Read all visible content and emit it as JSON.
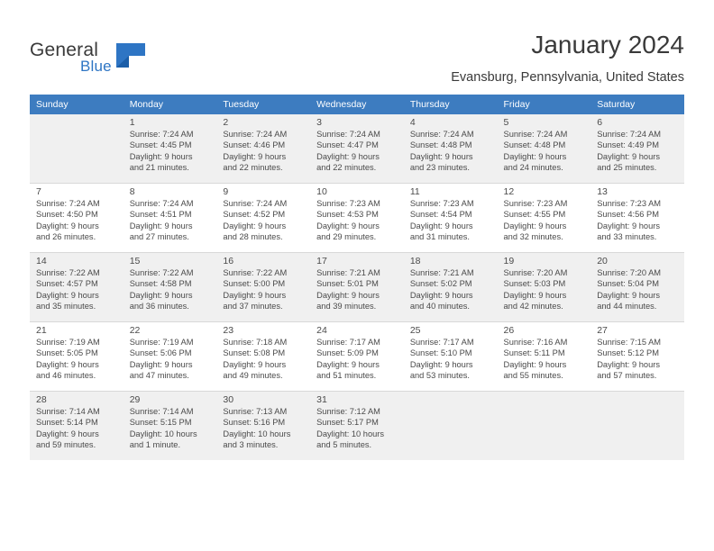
{
  "brand": {
    "name_part1": "General",
    "name_part2": "Blue",
    "logo_icon": "blue-flag-icon"
  },
  "header": {
    "title": "January 2024",
    "subtitle": "Evansburg, Pennsylvania, United States",
    "accent_color": "#3d7cc0",
    "alt_row_color": "#f0f0f0"
  },
  "calendar": {
    "weekdays": [
      "Sunday",
      "Monday",
      "Tuesday",
      "Wednesday",
      "Thursday",
      "Friday",
      "Saturday"
    ],
    "weeks": [
      [
        {
          "day": "",
          "sunrise": "",
          "sunset": "",
          "daylight1": "",
          "daylight2": ""
        },
        {
          "day": "1",
          "sunrise": "Sunrise: 7:24 AM",
          "sunset": "Sunset: 4:45 PM",
          "daylight1": "Daylight: 9 hours",
          "daylight2": "and 21 minutes."
        },
        {
          "day": "2",
          "sunrise": "Sunrise: 7:24 AM",
          "sunset": "Sunset: 4:46 PM",
          "daylight1": "Daylight: 9 hours",
          "daylight2": "and 22 minutes."
        },
        {
          "day": "3",
          "sunrise": "Sunrise: 7:24 AM",
          "sunset": "Sunset: 4:47 PM",
          "daylight1": "Daylight: 9 hours",
          "daylight2": "and 22 minutes."
        },
        {
          "day": "4",
          "sunrise": "Sunrise: 7:24 AM",
          "sunset": "Sunset: 4:48 PM",
          "daylight1": "Daylight: 9 hours",
          "daylight2": "and 23 minutes."
        },
        {
          "day": "5",
          "sunrise": "Sunrise: 7:24 AM",
          "sunset": "Sunset: 4:48 PM",
          "daylight1": "Daylight: 9 hours",
          "daylight2": "and 24 minutes."
        },
        {
          "day": "6",
          "sunrise": "Sunrise: 7:24 AM",
          "sunset": "Sunset: 4:49 PM",
          "daylight1": "Daylight: 9 hours",
          "daylight2": "and 25 minutes."
        }
      ],
      [
        {
          "day": "7",
          "sunrise": "Sunrise: 7:24 AM",
          "sunset": "Sunset: 4:50 PM",
          "daylight1": "Daylight: 9 hours",
          "daylight2": "and 26 minutes."
        },
        {
          "day": "8",
          "sunrise": "Sunrise: 7:24 AM",
          "sunset": "Sunset: 4:51 PM",
          "daylight1": "Daylight: 9 hours",
          "daylight2": "and 27 minutes."
        },
        {
          "day": "9",
          "sunrise": "Sunrise: 7:24 AM",
          "sunset": "Sunset: 4:52 PM",
          "daylight1": "Daylight: 9 hours",
          "daylight2": "and 28 minutes."
        },
        {
          "day": "10",
          "sunrise": "Sunrise: 7:23 AM",
          "sunset": "Sunset: 4:53 PM",
          "daylight1": "Daylight: 9 hours",
          "daylight2": "and 29 minutes."
        },
        {
          "day": "11",
          "sunrise": "Sunrise: 7:23 AM",
          "sunset": "Sunset: 4:54 PM",
          "daylight1": "Daylight: 9 hours",
          "daylight2": "and 31 minutes."
        },
        {
          "day": "12",
          "sunrise": "Sunrise: 7:23 AM",
          "sunset": "Sunset: 4:55 PM",
          "daylight1": "Daylight: 9 hours",
          "daylight2": "and 32 minutes."
        },
        {
          "day": "13",
          "sunrise": "Sunrise: 7:23 AM",
          "sunset": "Sunset: 4:56 PM",
          "daylight1": "Daylight: 9 hours",
          "daylight2": "and 33 minutes."
        }
      ],
      [
        {
          "day": "14",
          "sunrise": "Sunrise: 7:22 AM",
          "sunset": "Sunset: 4:57 PM",
          "daylight1": "Daylight: 9 hours",
          "daylight2": "and 35 minutes."
        },
        {
          "day": "15",
          "sunrise": "Sunrise: 7:22 AM",
          "sunset": "Sunset: 4:58 PM",
          "daylight1": "Daylight: 9 hours",
          "daylight2": "and 36 minutes."
        },
        {
          "day": "16",
          "sunrise": "Sunrise: 7:22 AM",
          "sunset": "Sunset: 5:00 PM",
          "daylight1": "Daylight: 9 hours",
          "daylight2": "and 37 minutes."
        },
        {
          "day": "17",
          "sunrise": "Sunrise: 7:21 AM",
          "sunset": "Sunset: 5:01 PM",
          "daylight1": "Daylight: 9 hours",
          "daylight2": "and 39 minutes."
        },
        {
          "day": "18",
          "sunrise": "Sunrise: 7:21 AM",
          "sunset": "Sunset: 5:02 PM",
          "daylight1": "Daylight: 9 hours",
          "daylight2": "and 40 minutes."
        },
        {
          "day": "19",
          "sunrise": "Sunrise: 7:20 AM",
          "sunset": "Sunset: 5:03 PM",
          "daylight1": "Daylight: 9 hours",
          "daylight2": "and 42 minutes."
        },
        {
          "day": "20",
          "sunrise": "Sunrise: 7:20 AM",
          "sunset": "Sunset: 5:04 PM",
          "daylight1": "Daylight: 9 hours",
          "daylight2": "and 44 minutes."
        }
      ],
      [
        {
          "day": "21",
          "sunrise": "Sunrise: 7:19 AM",
          "sunset": "Sunset: 5:05 PM",
          "daylight1": "Daylight: 9 hours",
          "daylight2": "and 46 minutes."
        },
        {
          "day": "22",
          "sunrise": "Sunrise: 7:19 AM",
          "sunset": "Sunset: 5:06 PM",
          "daylight1": "Daylight: 9 hours",
          "daylight2": "and 47 minutes."
        },
        {
          "day": "23",
          "sunrise": "Sunrise: 7:18 AM",
          "sunset": "Sunset: 5:08 PM",
          "daylight1": "Daylight: 9 hours",
          "daylight2": "and 49 minutes."
        },
        {
          "day": "24",
          "sunrise": "Sunrise: 7:17 AM",
          "sunset": "Sunset: 5:09 PM",
          "daylight1": "Daylight: 9 hours",
          "daylight2": "and 51 minutes."
        },
        {
          "day": "25",
          "sunrise": "Sunrise: 7:17 AM",
          "sunset": "Sunset: 5:10 PM",
          "daylight1": "Daylight: 9 hours",
          "daylight2": "and 53 minutes."
        },
        {
          "day": "26",
          "sunrise": "Sunrise: 7:16 AM",
          "sunset": "Sunset: 5:11 PM",
          "daylight1": "Daylight: 9 hours",
          "daylight2": "and 55 minutes."
        },
        {
          "day": "27",
          "sunrise": "Sunrise: 7:15 AM",
          "sunset": "Sunset: 5:12 PM",
          "daylight1": "Daylight: 9 hours",
          "daylight2": "and 57 minutes."
        }
      ],
      [
        {
          "day": "28",
          "sunrise": "Sunrise: 7:14 AM",
          "sunset": "Sunset: 5:14 PM",
          "daylight1": "Daylight: 9 hours",
          "daylight2": "and 59 minutes."
        },
        {
          "day": "29",
          "sunrise": "Sunrise: 7:14 AM",
          "sunset": "Sunset: 5:15 PM",
          "daylight1": "Daylight: 10 hours",
          "daylight2": "and 1 minute."
        },
        {
          "day": "30",
          "sunrise": "Sunrise: 7:13 AM",
          "sunset": "Sunset: 5:16 PM",
          "daylight1": "Daylight: 10 hours",
          "daylight2": "and 3 minutes."
        },
        {
          "day": "31",
          "sunrise": "Sunrise: 7:12 AM",
          "sunset": "Sunset: 5:17 PM",
          "daylight1": "Daylight: 10 hours",
          "daylight2": "and 5 minutes."
        },
        {
          "day": "",
          "sunrise": "",
          "sunset": "",
          "daylight1": "",
          "daylight2": ""
        },
        {
          "day": "",
          "sunrise": "",
          "sunset": "",
          "daylight1": "",
          "daylight2": ""
        },
        {
          "day": "",
          "sunrise": "",
          "sunset": "",
          "daylight1": "",
          "daylight2": ""
        }
      ]
    ]
  }
}
